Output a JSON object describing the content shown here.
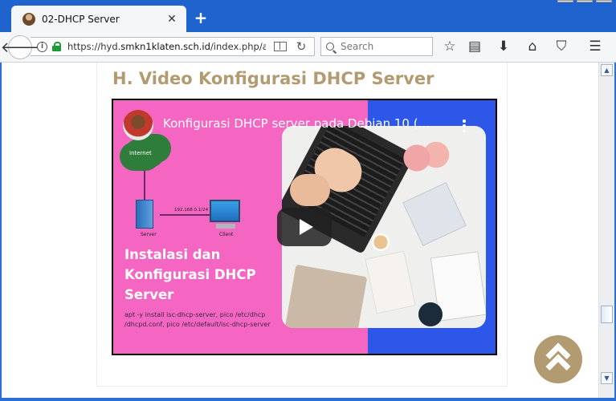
{
  "browser": {
    "tab_title": "02-DHCP Server",
    "tab_close": "✕",
    "new_tab": "+",
    "url_prefix": "https://hyd.",
    "url_host": "smkn1klaten.sch.id",
    "url_path": "/index.php/asj",
    "search_placeholder": "Search"
  },
  "icons": {
    "back": "back-arrow-icon",
    "info": "info-icon",
    "lock": "lock-icon",
    "reader": "reader-view-icon",
    "reload": "reload-icon",
    "search": "search-icon",
    "bookmark": "star-icon",
    "reading_list": "clipboard-icon",
    "download": "download-icon",
    "home": "home-icon",
    "pocket": "pocket-icon",
    "menu": "hamburger-menu-icon",
    "to_top": "double-chevron-up-icon"
  },
  "page": {
    "heading": "H. Video Konfigurasi DHCP Server",
    "heading_color": "#b39b71"
  },
  "video": {
    "title": "Konfigurasi DHCP server pada Debian 10 (...",
    "thumb_cloud_label": "Internet",
    "thumb_server_label": "Server",
    "thumb_client_label": "Client",
    "thumb_ip_label": "192.168.0.1/24",
    "thumb_heading": "Instalasi dan Konfigurasi DHCP Server",
    "thumb_commands": "apt -y install isc-dhcp-server, pico /etc/dhcp /dhcpd.conf, pico /etc/default/isc-dhcp-server",
    "pink": "#f466c2",
    "blue": "#2c57e8"
  },
  "colors": {
    "chrome_blue": "#1f63cf",
    "accent_gold": "#b39b71"
  }
}
